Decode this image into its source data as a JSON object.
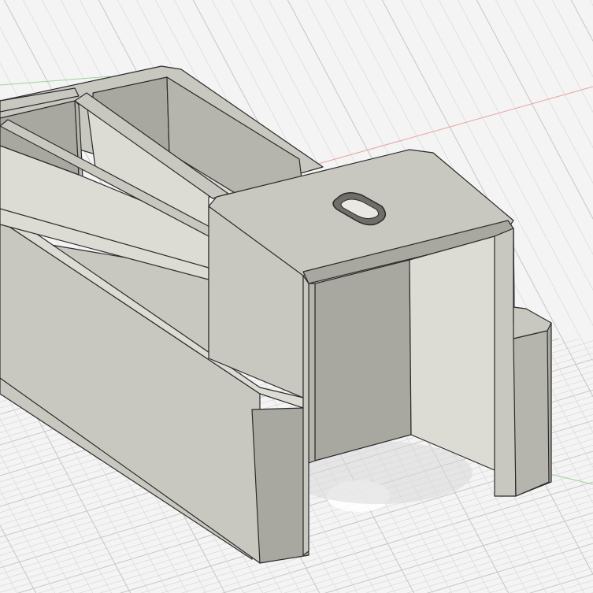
{
  "viewport": {
    "background": "#f4f4f4",
    "grid_minor_color": "#dcdcdc",
    "grid_major_color": "#c6c6c6",
    "axis_x_color": "#e7a3a3",
    "axis_y_color": "#9ad69a"
  },
  "model": {
    "body_color": "#c9c8c0",
    "light_face_color": "#dcdbd4",
    "dark_face_color": "#a9a8a0",
    "inner_shadow_color": "#b6b5ad",
    "edge_color": "#2a2a2a"
  }
}
